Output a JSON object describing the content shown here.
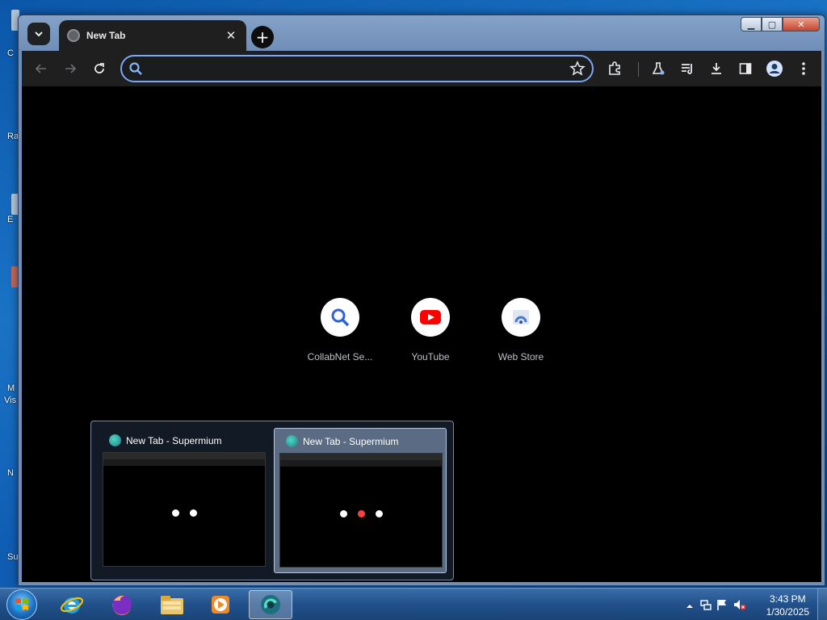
{
  "desktop": {
    "edge_labels": [
      "C",
      "Ra",
      "E",
      "M",
      "Vis",
      "N",
      "Su"
    ]
  },
  "window": {
    "controls": {
      "minimize": "▁",
      "maximize": "▢",
      "close": "✕"
    }
  },
  "browser": {
    "tab": {
      "title": "New Tab",
      "close": "✕"
    },
    "new_tab": "+",
    "omnibox": {
      "value": "",
      "placeholder": ""
    },
    "toolbar_icons": [
      "back-icon",
      "forward-icon",
      "reload-icon",
      "search-icon",
      "bookmark-star-icon",
      "extensions-icon",
      "labs-icon",
      "media-control-icon",
      "download-icon",
      "side-panel-icon",
      "profile-icon",
      "menu-icon"
    ]
  },
  "new_tab_page": {
    "shortcuts": [
      {
        "label": "CollabNet Se...",
        "icon": "search-icon"
      },
      {
        "label": "YouTube",
        "icon": "youtube-icon",
        "color": "#ff0000"
      },
      {
        "label": "Web Store",
        "icon": "web-store-icon"
      }
    ]
  },
  "taskbar_preview": {
    "items": [
      {
        "title": "New Tab - Supermium",
        "active": false
      },
      {
        "title": "New Tab - Supermium",
        "active": true
      }
    ]
  },
  "taskbar": {
    "apps": [
      "internet-explorer-icon",
      "firefox-icon",
      "file-explorer-icon",
      "media-player-icon",
      "supermium-icon"
    ],
    "clock": {
      "time": "3:43 PM",
      "date": "1/30/2025"
    }
  },
  "colors": {
    "accent": "#7aa7f7",
    "browser_dark": "#1f1f1f",
    "taskbar": "#21508a"
  }
}
